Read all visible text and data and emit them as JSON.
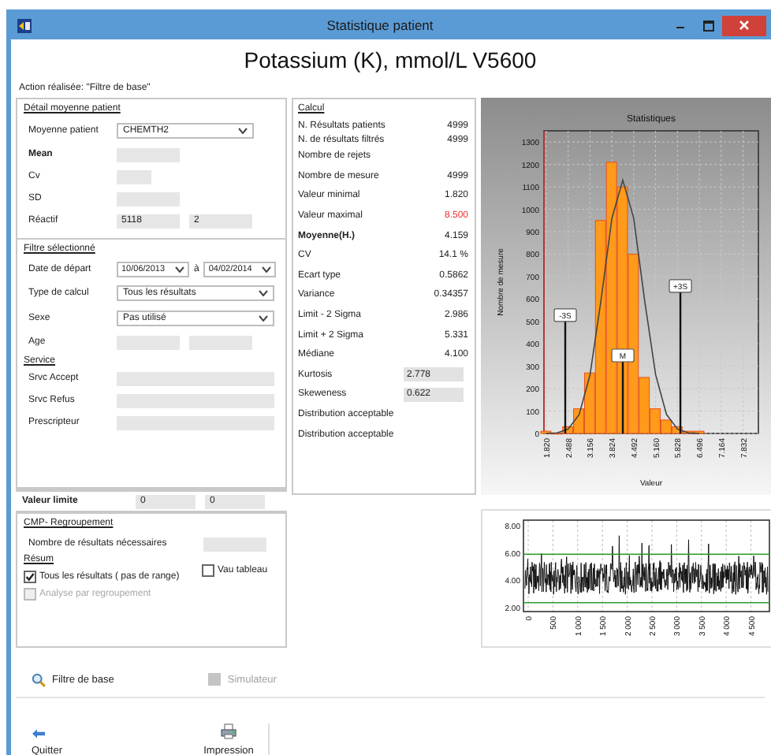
{
  "window": {
    "title": "Statistique patient"
  },
  "heading": "Potassium (K), mmol/L V5600",
  "action": "Action réalisée: \"Filtre de base\"",
  "patient_mean": {
    "title": "Détail moyenne patient",
    "rows": [
      {
        "label": "Moyenne patient",
        "kind": "select",
        "value": "CHEMTH2",
        "bold": false
      },
      {
        "label": "Mean",
        "kind": "box",
        "bold": true
      },
      {
        "label": "Cv",
        "kind": "short_box",
        "bold": false
      },
      {
        "label": "SD",
        "kind": "box",
        "bold": false
      },
      {
        "label": "Réactif",
        "kind": "pair",
        "values": [
          "5118",
          "2"
        ],
        "bold": false
      }
    ]
  },
  "filter": {
    "title": "Filtre sélectionné",
    "rows": [
      {
        "label": "Date de départ",
        "kind": "date_range",
        "values": [
          "10/06/2013",
          "04/02/2014"
        ],
        "separator": "à",
        "bold": false
      },
      {
        "label": "Type de calcul",
        "kind": "select",
        "value": "Tous les résultats",
        "bold": false
      },
      {
        "label": "Sexe",
        "kind": "select",
        "value": "Pas utilisé",
        "bold": false
      },
      {
        "label": "Age",
        "kind": "empty_pair",
        "bold": false
      },
      {
        "label": "Service",
        "kind": "subheading",
        "bold": false
      },
      {
        "label": "Srvc Accept",
        "kind": "long_box",
        "bold": false
      },
      {
        "label": "Srvc Refus",
        "kind": "long_box",
        "bold": false
      },
      {
        "label": "Prescripteur",
        "kind": "long_box",
        "bold": false
      }
    ]
  },
  "limit": {
    "label": "Valeur limite",
    "kind": "pair",
    "values": [
      "0",
      "0"
    ],
    "bold": true
  },
  "grouping": {
    "title": "CMP- Regroupement",
    "needed_label": "Nombre de résultats nécessaires",
    "summary_title": "Résum",
    "checkboxes": [
      {
        "label": "Tous les résultats ( pas de range)",
        "checked": true,
        "disabled": false
      },
      {
        "label": "Vau tableau",
        "checked": false,
        "disabled": false
      },
      {
        "label": "Analyse par regroupement",
        "checked": false,
        "disabled": true
      }
    ]
  },
  "calcul": {
    "title": "Calcul",
    "rows": [
      {
        "label": "N. Résultats patients",
        "value": "4999",
        "kind": "value",
        "bold": false,
        "alert": false
      },
      {
        "label": "N. de résultats filtrés",
        "value": "4999",
        "kind": "value",
        "bold": false,
        "alert": false
      },
      {
        "label": "Nombre de rejets",
        "kind": "value",
        "bold": false,
        "alert": false
      },
      {
        "label": "Nombre de mesure",
        "value": "4999",
        "kind": "value",
        "bold": false,
        "alert": false
      },
      {
        "label": "Valeur minimal",
        "value": "1.820",
        "kind": "value",
        "bold": false,
        "alert": false
      },
      {
        "label": "Valeur maximal",
        "value": "8.500",
        "kind": "value",
        "bold": false,
        "alert": true
      },
      {
        "label": "Moyenne(H.)",
        "value": "4.159",
        "kind": "value",
        "bold": true,
        "alert": false
      },
      {
        "label": "CV",
        "value": "14.1 %",
        "kind": "value",
        "bold": false,
        "alert": false
      },
      {
        "label": "Ecart  type",
        "value": "0.5862",
        "kind": "value",
        "bold": false,
        "alert": false
      },
      {
        "label": "Variance",
        "value": "0.34357",
        "kind": "value",
        "bold": false,
        "alert": false
      },
      {
        "label": "Limit - 2 Sigma",
        "value": "2.986",
        "kind": "value",
        "bold": false,
        "alert": false
      },
      {
        "label": "Limit + 2 Sigma",
        "value": "5.331",
        "kind": "value",
        "bold": false,
        "alert": false
      },
      {
        "label": "Médiane",
        "value": "4.100",
        "kind": "value",
        "bold": false,
        "alert": false
      },
      {
        "label": "Kurtosis",
        "value": "2.778",
        "kind": "boxed",
        "bold": false,
        "alert": false
      },
      {
        "label": "Skeweness",
        "value": "0.622",
        "kind": "boxed",
        "bold": false,
        "alert": false
      },
      {
        "label": "Distribution acceptable",
        "kind": "note",
        "bold": false,
        "alert": false
      },
      {
        "label": "Distribution acceptable",
        "kind": "note",
        "bold": false,
        "alert": false
      }
    ]
  },
  "histogram": {
    "chart_data": {
      "type": "bar",
      "title": "Statistiques",
      "xlabel": "Valeur",
      "ylabel": "Nombre de mesure",
      "x": [
        1.82,
        2.154,
        2.488,
        2.822,
        3.156,
        3.49,
        3.824,
        4.158,
        4.492,
        4.826,
        5.16,
        5.494,
        5.828,
        6.162,
        6.496
      ],
      "series": [
        {
          "type": "bar",
          "color": "#ff9a1a",
          "values": [
            10,
            0,
            30,
            110,
            270,
            950,
            1210,
            1100,
            800,
            250,
            110,
            60,
            30,
            10,
            10
          ]
        },
        {
          "type": "line",
          "color": "#444444",
          "values": [
            0,
            3,
            19,
            84,
            261,
            590,
            960,
            1130,
            961,
            591,
            263,
            85,
            20,
            3,
            0
          ]
        }
      ],
      "xlim": [
        1.75,
        8.3
      ],
      "ylim": [
        0,
        1350
      ],
      "grid": true,
      "xticks": [
        {
          "value": 1.82,
          "label": "1.820"
        },
        {
          "value": 2.488,
          "label": "2.488"
        },
        {
          "value": 3.156,
          "label": "3.156"
        },
        {
          "value": 3.824,
          "label": "3.824"
        },
        {
          "value": 4.492,
          "label": "4.492"
        },
        {
          "value": 5.16,
          "label": "5.160"
        },
        {
          "value": 5.828,
          "label": "5.828"
        },
        {
          "value": 6.496,
          "label": "6.496"
        },
        {
          "value": 7.164,
          "label": "7.164"
        },
        {
          "value": 7.832,
          "label": "7.832"
        }
      ],
      "yticks": [
        0,
        100,
        200,
        300,
        400,
        500,
        600,
        700,
        800,
        900,
        1000,
        1100,
        1200,
        1300
      ],
      "annotations": [
        "-3S",
        "M",
        "+3S"
      ]
    }
  },
  "run_chart": {
    "yticks": [
      "8.00",
      "6.00",
      "4.00",
      "2.00"
    ],
    "xticks": [
      "0",
      "500",
      "1 000",
      "1 500",
      "2 000",
      "2 500",
      "3 000",
      "3 500",
      "4 000",
      "4 500"
    ]
  },
  "toolbar": [
    {
      "label": "Filtre de base",
      "kind": "search",
      "disabled": false
    },
    {
      "label": "Simulateur",
      "kind": "toggle",
      "disabled": true
    }
  ],
  "buttons": [
    {
      "label": "Quitter",
      "kind": "quit"
    },
    {
      "label": "Impression",
      "kind": "print"
    }
  ]
}
